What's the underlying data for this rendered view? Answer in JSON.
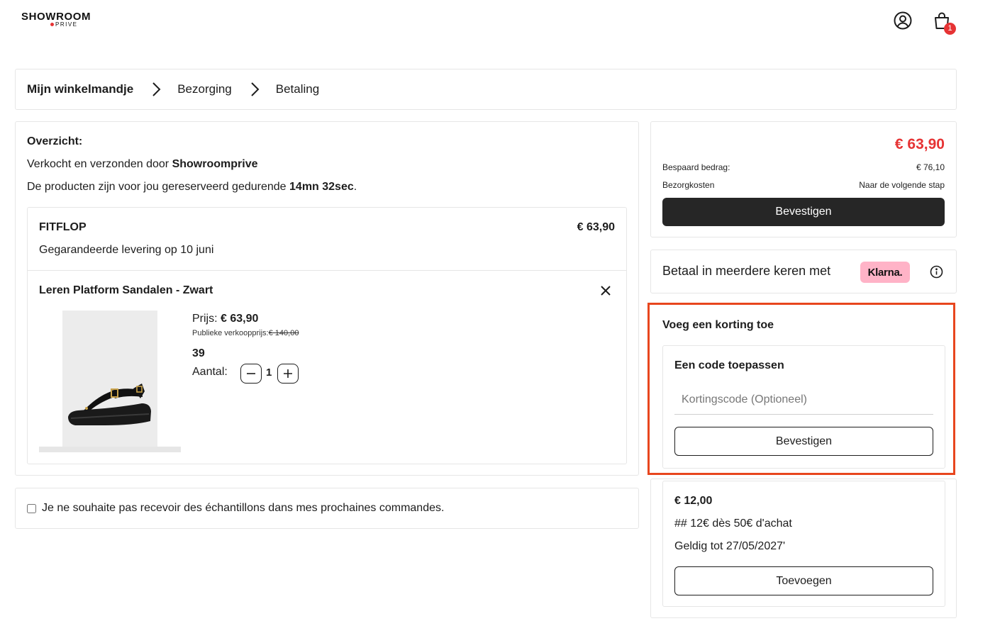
{
  "header": {
    "logo_main": "SHOWROOM",
    "logo_sub": "PRIVE",
    "account_icon": "user-circle-icon",
    "cart_icon": "shopping-bag-icon",
    "cart_count": "1",
    "accent_color": "#e63334"
  },
  "breadcrumb": {
    "steps": [
      {
        "label": "Mijn winkelmandje",
        "active": true
      },
      {
        "label": "Bezorging",
        "active": false
      },
      {
        "label": "Betaling",
        "active": false
      }
    ]
  },
  "overview": {
    "title": "Overzicht:",
    "sold_by_prefix": "Verkocht en verzonden door ",
    "sold_by_name": "Showroomprive",
    "reserved_prefix": "De producten zijn voor jou gereserveerd gedurende ",
    "reserved_time": "14mn 32sec",
    "reserved_suffix": ".",
    "brand": {
      "name": "FITFLOP",
      "price": "€ 63,90",
      "delivery": "Gegarandeerde levering op 10 juni"
    },
    "product": {
      "name": "Leren Platform Sandalen - Zwart",
      "price_label": "Prijs: ",
      "price": "€ 63,90",
      "public_price_label": "Publieke verkoopprijs:",
      "public_price": "€ 140,00",
      "size": "39",
      "quantity_label": "Aantal:",
      "quantity": "1"
    }
  },
  "samples": {
    "label": "Je ne souhaite pas recevoir des échantillons dans mes prochaines commandes.",
    "checked": false
  },
  "summary": {
    "total": "€ 63,90",
    "saved_label": "Bespaard bedrag:",
    "saved_value": "€ 76,10",
    "shipping_label": "Bezorgkosten",
    "shipping_value": "Naar de volgende stap",
    "confirm_label": "Bevestigen"
  },
  "klarna": {
    "text": "Betaal in meerdere keren met",
    "badge": "Klarna.",
    "badge_color": "#ffb3c7"
  },
  "discount": {
    "title": "Voeg een korting toe",
    "code_title": "Een code toepassen",
    "input_placeholder": "Kortingscode (Optioneel)",
    "input_value": "",
    "confirm_label": "Bevestigen",
    "highlight_color": "#e8461e"
  },
  "voucher": {
    "amount": "€ 12,00",
    "description": "## 12€ dès 50€ d'achat",
    "validity": "Geldig tot 27/05/2027'",
    "add_label": "Toevoegen"
  }
}
